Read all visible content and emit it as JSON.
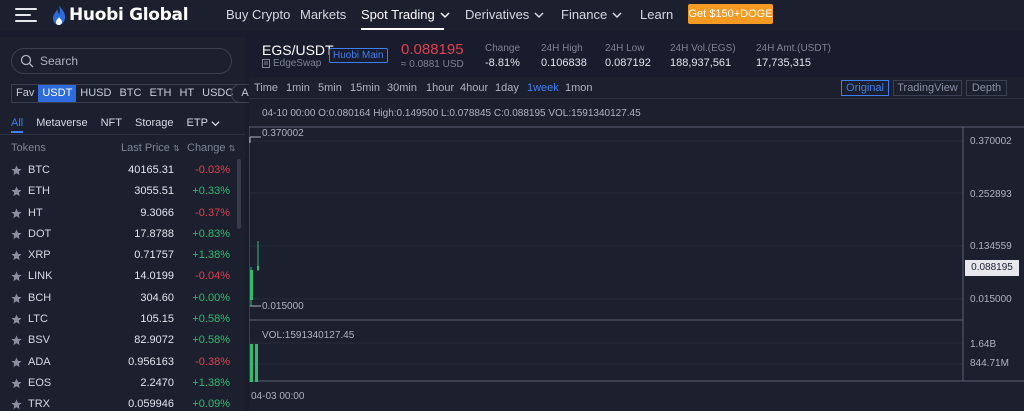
{
  "nav": {
    "brand": "Huobi Global",
    "items": [
      {
        "label": "Buy Crypto",
        "dropdown": false,
        "active": false
      },
      {
        "label": "Markets",
        "dropdown": false,
        "active": false
      },
      {
        "label": "Spot Trading",
        "dropdown": true,
        "active": true
      },
      {
        "label": "Derivatives",
        "dropdown": true,
        "active": false
      },
      {
        "label": "Finance",
        "dropdown": true,
        "active": false
      },
      {
        "label": "Learn",
        "dropdown": false,
        "active": false
      }
    ],
    "promo": "Get $150+DOGE"
  },
  "left": {
    "search_placeholder": "Search",
    "quote_tabs": [
      "Fav",
      "USDT",
      "HUSD",
      "BTC",
      "ETH",
      "HT",
      "USDC",
      "ALTS"
    ],
    "quote_active": "USDT",
    "category_tabs": [
      "All",
      "Metaverse",
      "NFT",
      "Storage",
      "ETP"
    ],
    "category_active": "All",
    "headers": {
      "token": "Tokens",
      "price": "Last Price",
      "change": "Change"
    },
    "rows": [
      {
        "sym": "BTC",
        "price": "40165.31",
        "change": "-0.03%",
        "dir": "down"
      },
      {
        "sym": "ETH",
        "price": "3055.51",
        "change": "+0.33%",
        "dir": "up"
      },
      {
        "sym": "HT",
        "price": "9.3066",
        "change": "-0.37%",
        "dir": "down"
      },
      {
        "sym": "DOT",
        "price": "17.8788",
        "change": "+0.83%",
        "dir": "up"
      },
      {
        "sym": "XRP",
        "price": "0.71757",
        "change": "+1.38%",
        "dir": "up"
      },
      {
        "sym": "LINK",
        "price": "14.0199",
        "change": "-0.04%",
        "dir": "down"
      },
      {
        "sym": "BCH",
        "price": "304.60",
        "change": "+0.00%",
        "dir": "up"
      },
      {
        "sym": "LTC",
        "price": "105.15",
        "change": "+0.58%",
        "dir": "up"
      },
      {
        "sym": "BSV",
        "price": "82.9072",
        "change": "+0.58%",
        "dir": "up"
      },
      {
        "sym": "ADA",
        "price": "0.956163",
        "change": "-0.38%",
        "dir": "down"
      },
      {
        "sym": "EOS",
        "price": "2.2470",
        "change": "+1.38%",
        "dir": "up"
      },
      {
        "sym": "TRX",
        "price": "0.059946",
        "change": "+0.09%",
        "dir": "up"
      }
    ]
  },
  "ticker": {
    "pair": "EGS/USDT",
    "badge": "Huobi Main",
    "coin_name": "EdgeSwap",
    "last_price": "0.088195",
    "approx": "≈ 0.0881 USD",
    "stats": [
      {
        "label": "Change",
        "value": "-8.81%",
        "dir": "down"
      },
      {
        "label": "24H High",
        "value": "0.106838",
        "dir": ""
      },
      {
        "label": "24H Low",
        "value": "0.087192",
        "dir": ""
      },
      {
        "label": "24H Vol.(EGS)",
        "value": "188,937,561",
        "dir": ""
      },
      {
        "label": "24H Amt.(USDT)",
        "value": "17,735,315",
        "dir": ""
      }
    ]
  },
  "chart": {
    "intervals": [
      "Time",
      "1min",
      "5min",
      "15min",
      "30min",
      "1hour",
      "4hour",
      "1day",
      "1week",
      "1mon"
    ],
    "interval_active": "1week",
    "views": [
      "Original",
      "TradingView",
      "Depth"
    ],
    "view_active": "Original",
    "ohlc": "04-10 00:00   O:0.080164   High:0.149500   L:0.078845   C:0.088195   VOL:1591340127.45",
    "high_label": "0.370002",
    "low_label": "0.015000",
    "axis_labels": [
      "0.370002",
      "0.252893",
      "0.134559",
      "0.015000"
    ],
    "current_price": "0.088195",
    "vol_text": "VOL:1591340127.45",
    "vol_axis": [
      "1.64B",
      "844.71M"
    ],
    "date_label": "04-03 00:00",
    "colors": {
      "up": "#2fbc6e",
      "down": "#e0404f",
      "accent": "#3f7ff2"
    }
  }
}
